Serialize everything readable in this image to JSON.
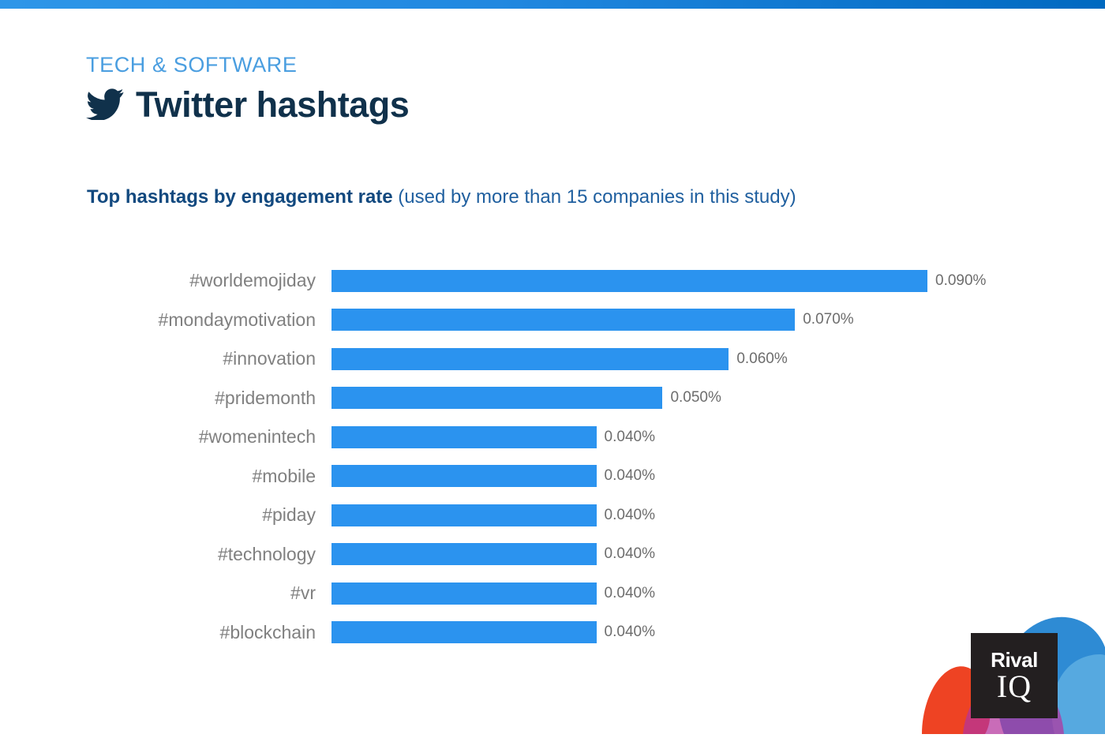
{
  "header": {
    "eyebrow": "TECH & SOFTWARE",
    "title": "Twitter hashtags",
    "icon": "twitter-bird-icon"
  },
  "subtitle": {
    "strong": "Top hashtags by engagement rate",
    "rest": " (used by more than 15 companies in this study)"
  },
  "logo": {
    "line1": "Rival",
    "line2": "IQ"
  },
  "colors": {
    "bar": "#2b93ef",
    "eyebrow": "#4a9ee0",
    "title": "#10314b",
    "subtitle": "#1c5c9e",
    "category_label": "#808080",
    "value_label": "#6d6d6d",
    "top_bar_start": "#2e96e8",
    "top_bar_end": "#0069c0",
    "logo_box": "#231f20",
    "blob_blue": "#2e8bd4",
    "blob_light_blue": "#56a9e0",
    "blob_red": "#ee4323",
    "blob_purple": "#b4339c"
  },
  "chart_data": {
    "type": "bar",
    "orientation": "horizontal",
    "title": "Top hashtags by engagement rate",
    "subtitle": "(used by more than 15 companies in this study)",
    "xlabel": "",
    "ylabel": "",
    "grid": false,
    "legend": false,
    "value_format": "0.000%",
    "xlim": [
      0,
      0.09
    ],
    "categories": [
      "#worldemojiday",
      "#mondaymotivation",
      "#innovation",
      "#pridemonth",
      "#womenintech",
      "#mobile",
      "#piday",
      "#technology",
      "#vr",
      "#blockchain"
    ],
    "values": [
      0.09,
      0.07,
      0.06,
      0.05,
      0.04,
      0.04,
      0.04,
      0.04,
      0.04,
      0.04
    ],
    "value_labels": [
      "0.090%",
      "0.070%",
      "0.060%",
      "0.050%",
      "0.040%",
      "0.040%",
      "0.040%",
      "0.040%",
      "0.040%",
      "0.040%"
    ]
  }
}
